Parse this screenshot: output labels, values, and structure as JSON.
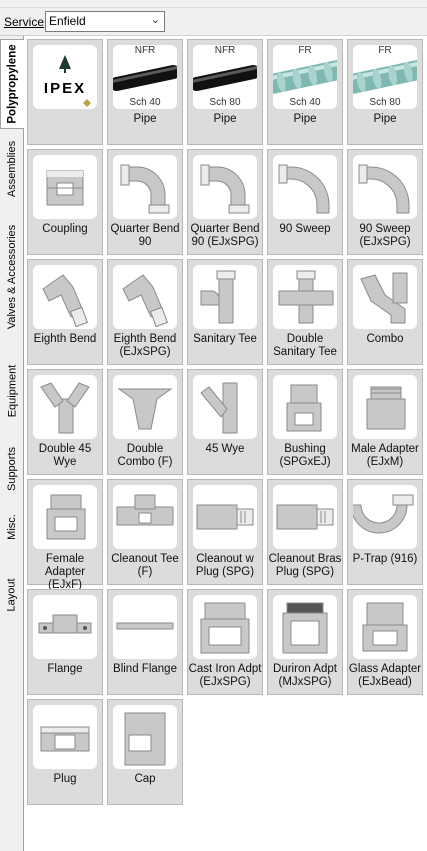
{
  "service": {
    "label": "Service",
    "value": "Enfield"
  },
  "tabs": [
    {
      "label": "Polypropylene",
      "active": true
    },
    {
      "label": "Assemblies"
    },
    {
      "label": "Valves & Accessories"
    },
    {
      "label": "Equipment"
    },
    {
      "label": "Supports"
    },
    {
      "label": "Misc."
    },
    {
      "label": "Layout"
    }
  ],
  "items": [
    {
      "label": "",
      "icon": "ipex-logo-icon",
      "logo_text": "IPEX"
    },
    {
      "label": "Pipe",
      "icon": "black-pipe-icon",
      "top": "NFR",
      "bottom": "Sch 40"
    },
    {
      "label": "Pipe",
      "icon": "black-pipe-icon",
      "top": "NFR",
      "bottom": "Sch 80"
    },
    {
      "label": "Pipe",
      "icon": "teal-pipe-icon",
      "top": "FR",
      "bottom": "Sch 40"
    },
    {
      "label": "Pipe",
      "icon": "teal-pipe-icon",
      "top": "FR",
      "bottom": "Sch 80"
    },
    {
      "label": "Coupling",
      "icon": "coupling-icon"
    },
    {
      "label": "Quarter Bend 90",
      "icon": "quarter-bend-icon"
    },
    {
      "label": "Quarter Bend 90 (EJxSPG)",
      "icon": "quarter-bend-spigot-icon"
    },
    {
      "label": "90 Sweep",
      "icon": "sweep-90-icon"
    },
    {
      "label": "90 Sweep (EJxSPG)",
      "icon": "sweep-90-spigot-icon"
    },
    {
      "label": "Eighth Bend",
      "icon": "eighth-bend-icon"
    },
    {
      "label": "Eighth Bend (EJxSPG)",
      "icon": "eighth-bend-spigot-icon"
    },
    {
      "label": "Sanitary Tee",
      "icon": "sanitary-tee-icon"
    },
    {
      "label": "Double Sanitary Tee",
      "icon": "double-sanitary-tee-icon"
    },
    {
      "label": "Combo",
      "icon": "combo-icon"
    },
    {
      "label": "Double 45 Wye",
      "icon": "double-wye-icon"
    },
    {
      "label": "Double Combo (F)",
      "icon": "double-combo-icon"
    },
    {
      "label": "45 Wye",
      "icon": "wye-45-icon"
    },
    {
      "label": "Bushing (SPGxEJ)",
      "icon": "bushing-icon"
    },
    {
      "label": "Male Adapter (EJxM)",
      "icon": "male-adapter-icon"
    },
    {
      "label": "Female Adapter (EJxF)",
      "icon": "female-adapter-icon"
    },
    {
      "label": "Cleanout Tee (F)",
      "icon": "cleanout-tee-icon"
    },
    {
      "label": "Cleanout w Plug (SPG)",
      "icon": "cleanout-plug-icon"
    },
    {
      "label": "Cleanout Bras Plug (SPG)",
      "icon": "cleanout-brass-plug-icon"
    },
    {
      "label": "P-Trap (916)",
      "icon": "p-trap-icon"
    },
    {
      "label": "Flange",
      "icon": "flange-icon"
    },
    {
      "label": "Blind Flange",
      "icon": "blind-flange-icon"
    },
    {
      "label": "Cast Iron Adpt (EJxSPG)",
      "icon": "cast-iron-adapter-icon"
    },
    {
      "label": "Duriron Adpt (MJxSPG)",
      "icon": "duriron-adapter-icon"
    },
    {
      "label": "Glass Adapter (EJxBead)",
      "icon": "glass-adapter-icon"
    },
    {
      "label": "Plug",
      "icon": "plug-icon"
    },
    {
      "label": "Cap",
      "icon": "cap-icon"
    }
  ]
}
